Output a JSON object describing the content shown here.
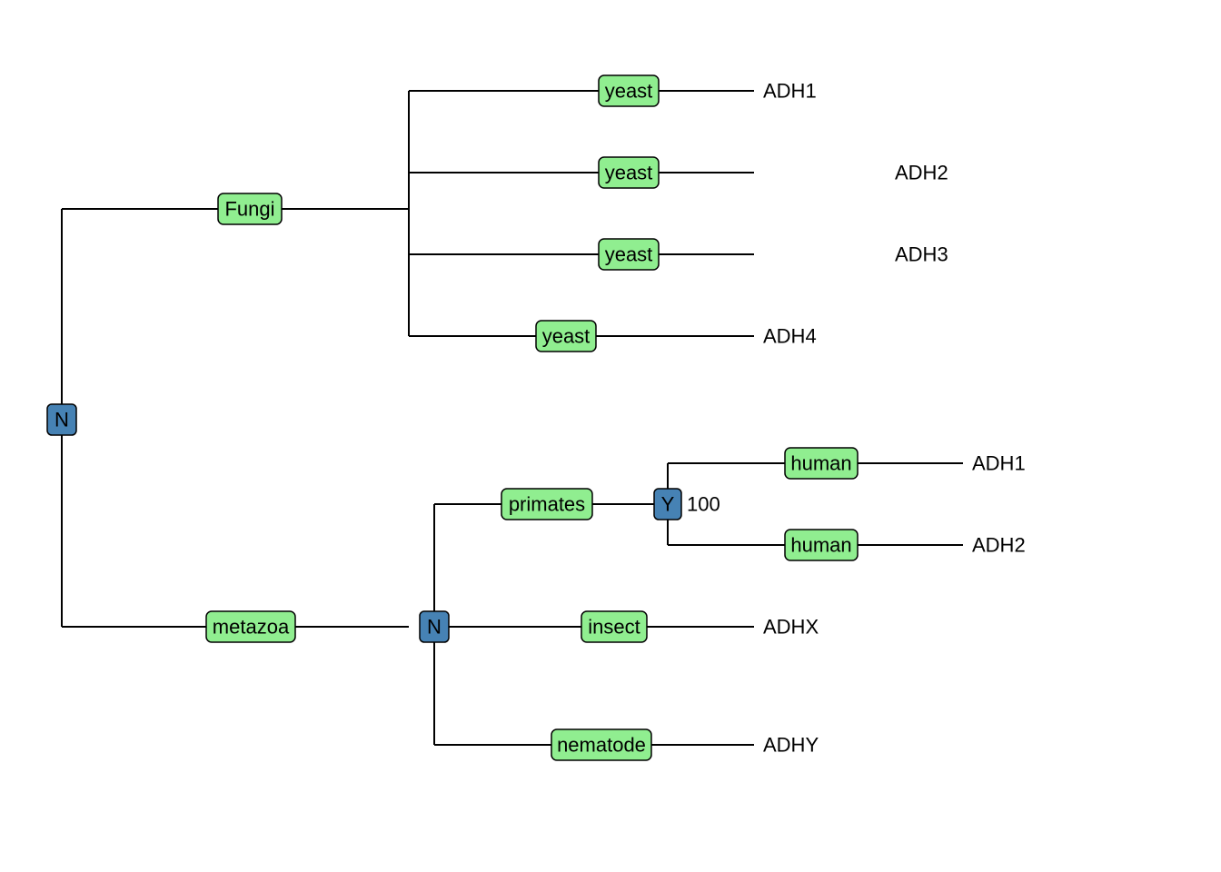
{
  "root": {
    "label": "N"
  },
  "fungi": {
    "label": "Fungi",
    "children": [
      {
        "species": "yeast",
        "gene": "ADH1"
      },
      {
        "species": "yeast",
        "gene": "ADH2"
      },
      {
        "species": "yeast",
        "gene": "ADH3"
      },
      {
        "species": "yeast",
        "gene": "ADH4"
      }
    ]
  },
  "metazoa": {
    "label": "metazoa",
    "node": {
      "label": "N"
    },
    "primates": {
      "label": "primates",
      "node": {
        "label": "Y",
        "support": "100"
      },
      "children": [
        {
          "species": "human",
          "gene": "ADH1"
        },
        {
          "species": "human",
          "gene": "ADH2"
        }
      ]
    },
    "insect": {
      "species": "insect",
      "gene": "ADHX"
    },
    "nematode": {
      "species": "nematode",
      "gene": "ADHY"
    }
  }
}
